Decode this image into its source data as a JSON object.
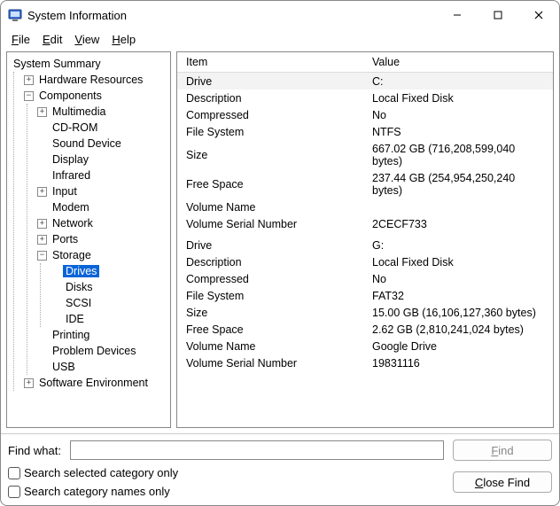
{
  "window": {
    "title": "System Information"
  },
  "menu": {
    "file": "File",
    "edit": "Edit",
    "view": "View",
    "help": "Help"
  },
  "tree": {
    "root": "System Summary",
    "hardware": "Hardware Resources",
    "components": "Components",
    "comp": {
      "multimedia": "Multimedia",
      "cdrom": "CD-ROM",
      "sound": "Sound Device",
      "display": "Display",
      "infrared": "Infrared",
      "input": "Input",
      "modem": "Modem",
      "network": "Network",
      "ports": "Ports",
      "storage": "Storage",
      "st": {
        "drives": "Drives",
        "disks": "Disks",
        "scsi": "SCSI",
        "ide": "IDE"
      },
      "printing": "Printing",
      "problem": "Problem Devices",
      "usb": "USB"
    },
    "software": "Software Environment"
  },
  "table": {
    "headers": {
      "item": "Item",
      "value": "Value"
    },
    "rows": [
      {
        "item": "Drive",
        "value": "C:",
        "hl": true
      },
      {
        "item": "Description",
        "value": "Local Fixed Disk"
      },
      {
        "item": "Compressed",
        "value": "No"
      },
      {
        "item": "File System",
        "value": "NTFS"
      },
      {
        "item": "Size",
        "value": "667.02 GB (716,208,599,040 bytes)"
      },
      {
        "item": "Free Space",
        "value": "237.44 GB (254,954,250,240 bytes)"
      },
      {
        "item": "Volume Name",
        "value": ""
      },
      {
        "item": "Volume Serial Number",
        "value": "2CECF733"
      },
      {
        "item": "",
        "value": ""
      },
      {
        "item": "Drive",
        "value": "G:"
      },
      {
        "item": "Description",
        "value": "Local Fixed Disk"
      },
      {
        "item": "Compressed",
        "value": "No"
      },
      {
        "item": "File System",
        "value": "FAT32"
      },
      {
        "item": "Size",
        "value": "15.00 GB (16,106,127,360 bytes)"
      },
      {
        "item": "Free Space",
        "value": "2.62 GB (2,810,241,024 bytes)"
      },
      {
        "item": "Volume Name",
        "value": "Google Drive"
      },
      {
        "item": "Volume Serial Number",
        "value": "19831116"
      }
    ]
  },
  "find": {
    "label": "Find what:",
    "find_btn": "Find",
    "close_btn": "Close Find",
    "chk_selected": "Search selected category only",
    "chk_names": "Search category names only"
  }
}
